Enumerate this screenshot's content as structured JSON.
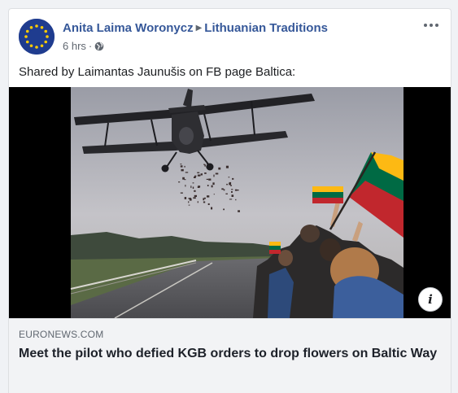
{
  "post": {
    "author": "Anita Laima Woronycz",
    "group": "Lithuanian Traditions",
    "time": "6 hrs",
    "separator": "·",
    "privacy_icon": "globe-icon",
    "more_icon": "more-options-icon",
    "text": "Shared by Laimantas Jaunušis on FB page Baltica:"
  },
  "link": {
    "domain": "EURONEWS.COM",
    "title": "Meet the pilot who defied KGB orders to drop flowers on Baltic Way",
    "info_label": "i",
    "info_icon": "info-icon"
  },
  "colors": {
    "link": "#365899",
    "flag_yellow": "#fdb913",
    "flag_green": "#006a44",
    "flag_red": "#c1272d",
    "eu_blue": "#1f3c8f",
    "eu_star": "#ffcc00"
  }
}
